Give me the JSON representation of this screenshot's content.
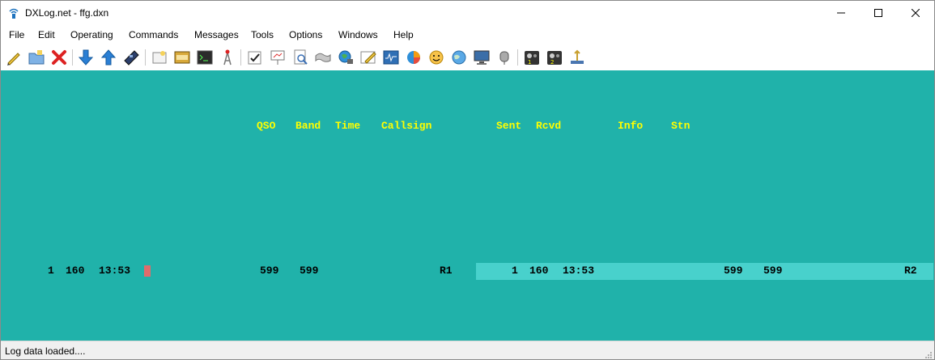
{
  "window": {
    "title": "DXLog.net - ffg.dxn",
    "app_icon": "dxlog-antenna-icon"
  },
  "menu": [
    "File",
    "Edit",
    "Operating",
    "Commands",
    "Messages",
    "Tools",
    "Options",
    "Windows",
    "Help"
  ],
  "toolbar": {
    "icons": [
      "new-log-icon",
      "open-log-icon",
      "delete-icon",
      "download-icon",
      "upload-icon",
      "cw-keyer-icon",
      "notes-icon",
      "scratchpad-icon",
      "terminal-icon",
      "antenna-icon",
      "check-icon",
      "presentation-icon",
      "preview-icon",
      "map-icon",
      "globe-network-icon",
      "edit-icon",
      "bandmap-icon",
      "pie-chart-icon",
      "smiley-icon",
      "world-icon",
      "monitor-icon",
      "microphone-icon",
      "radio-1-icon",
      "radio-2-icon",
      "cw-key-icon"
    ]
  },
  "log": {
    "headers": {
      "qso": "QSO",
      "band": "Band",
      "time": "Time",
      "callsign": "Callsign",
      "sent": "Sent",
      "rcvd": "Rcvd",
      "info": "Info",
      "stn": "Stn"
    },
    "left_entry": {
      "qso": "1",
      "band": "160",
      "time": "13:53",
      "sent": "599",
      "rcvd": "599",
      "stn": "R1"
    },
    "right_entry": {
      "qso": "1",
      "band": "160",
      "time": "13:53",
      "sent": "599",
      "rcvd": "599",
      "stn": "R2"
    }
  },
  "status": {
    "text": "Log data loaded...."
  },
  "colors": {
    "background": "#20b2aa",
    "header_text": "#ffff00",
    "highlight_row": "#48d1cc",
    "cursor": "#e06c6c"
  }
}
